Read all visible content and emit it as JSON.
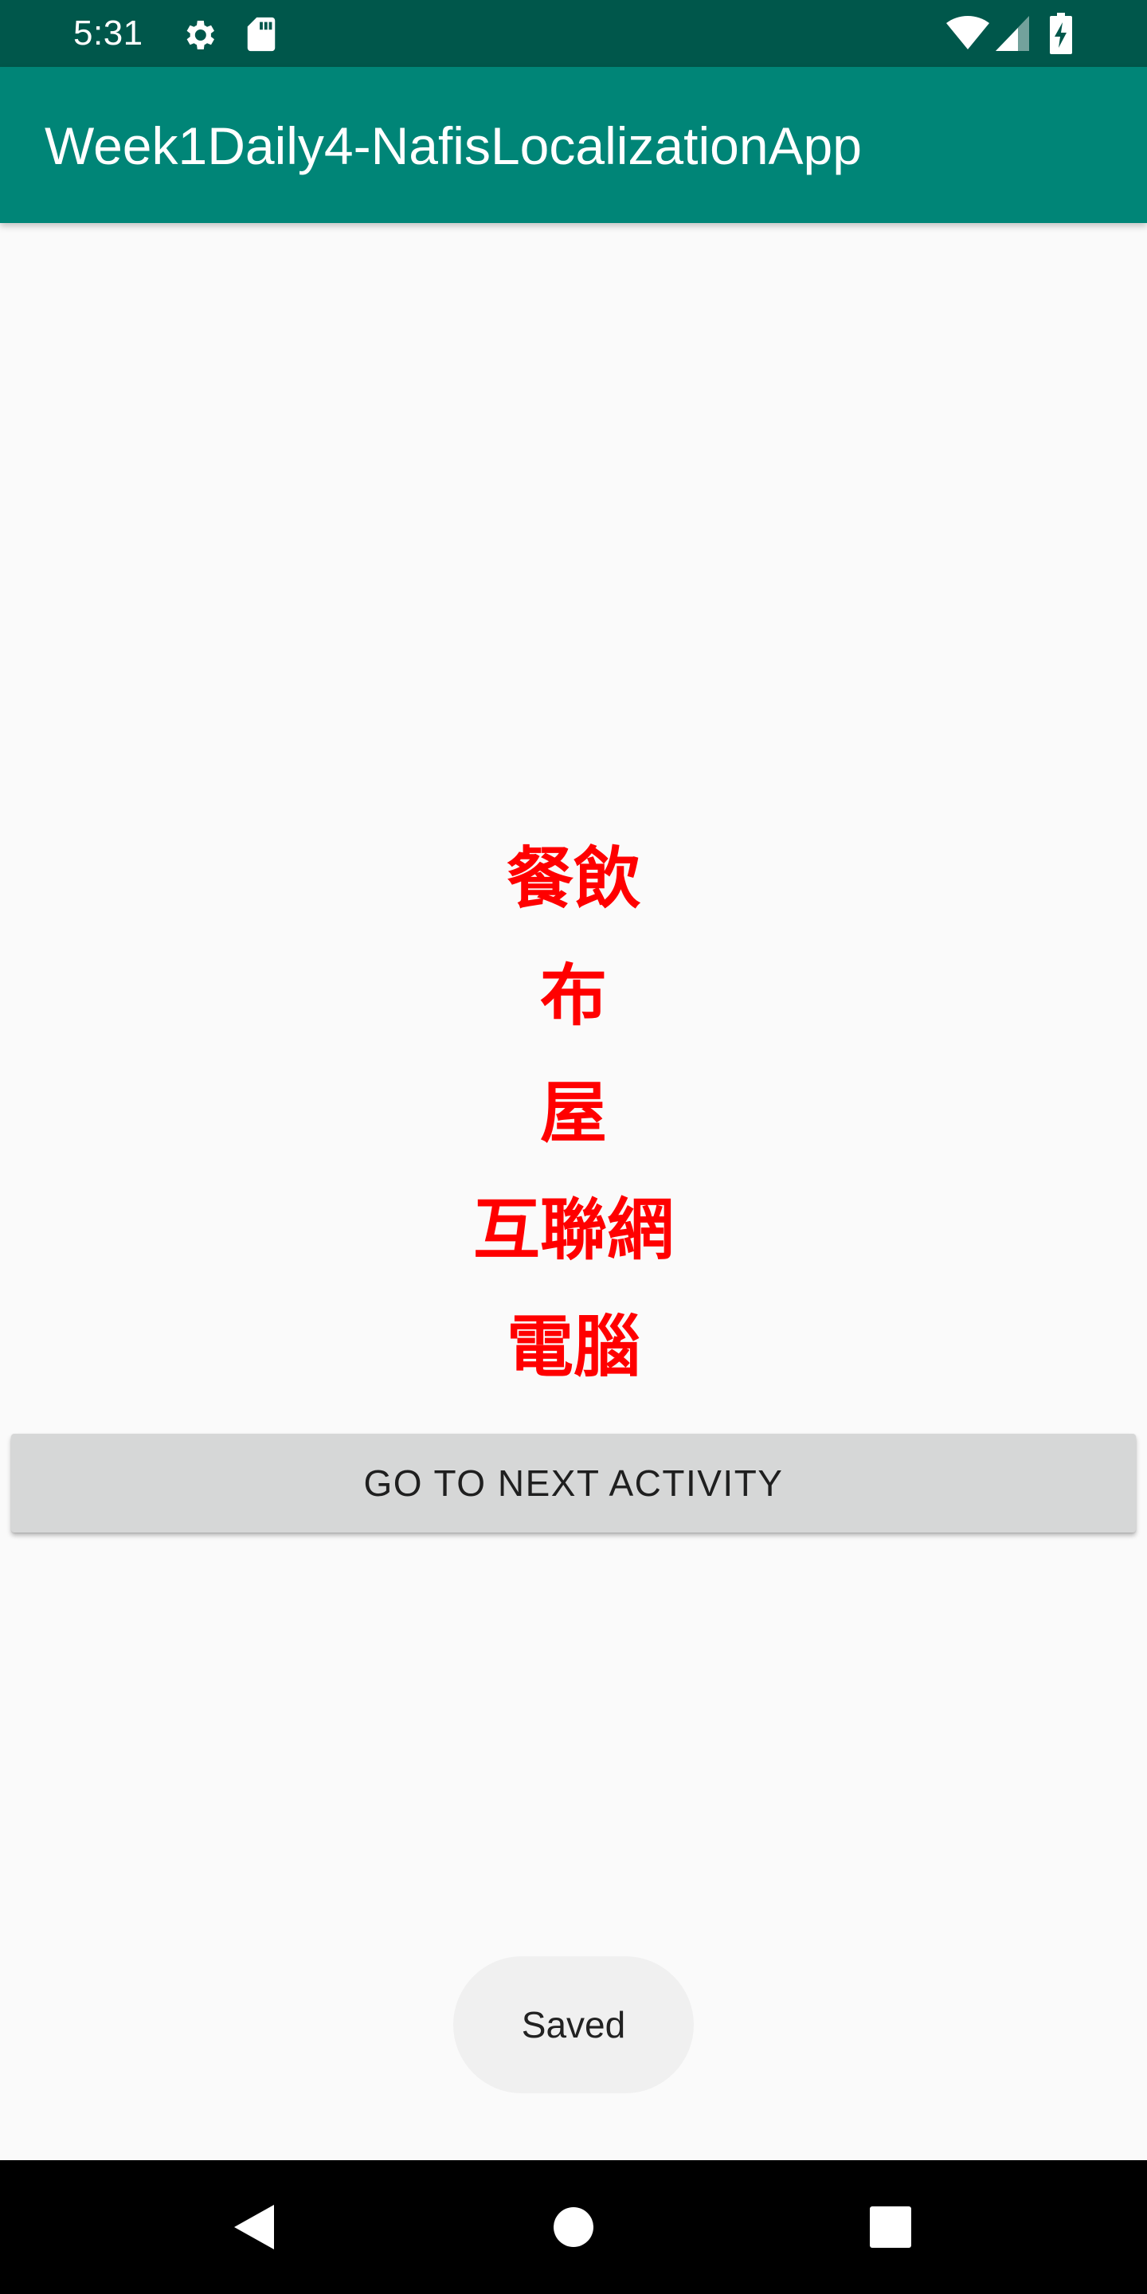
{
  "status_bar": {
    "time": "5:31",
    "icons": [
      "gear-icon",
      "sd-card-icon",
      "wifi-icon",
      "cell-signal-icon",
      "battery-charging-icon"
    ],
    "background": "#00574b"
  },
  "app_bar": {
    "title": "Week1Daily4-NafisLocalizationApp",
    "background": "#008577"
  },
  "main": {
    "words": [
      "餐飲",
      "布",
      "屋",
      "互聯網",
      "電腦"
    ],
    "word_color": "#ff0000",
    "next_button_label": "GO TO NEXT ACTIVITY"
  },
  "toast": {
    "message": "Saved"
  },
  "nav_bar": {
    "buttons": [
      "back-icon",
      "home-icon",
      "recents-icon"
    ]
  }
}
